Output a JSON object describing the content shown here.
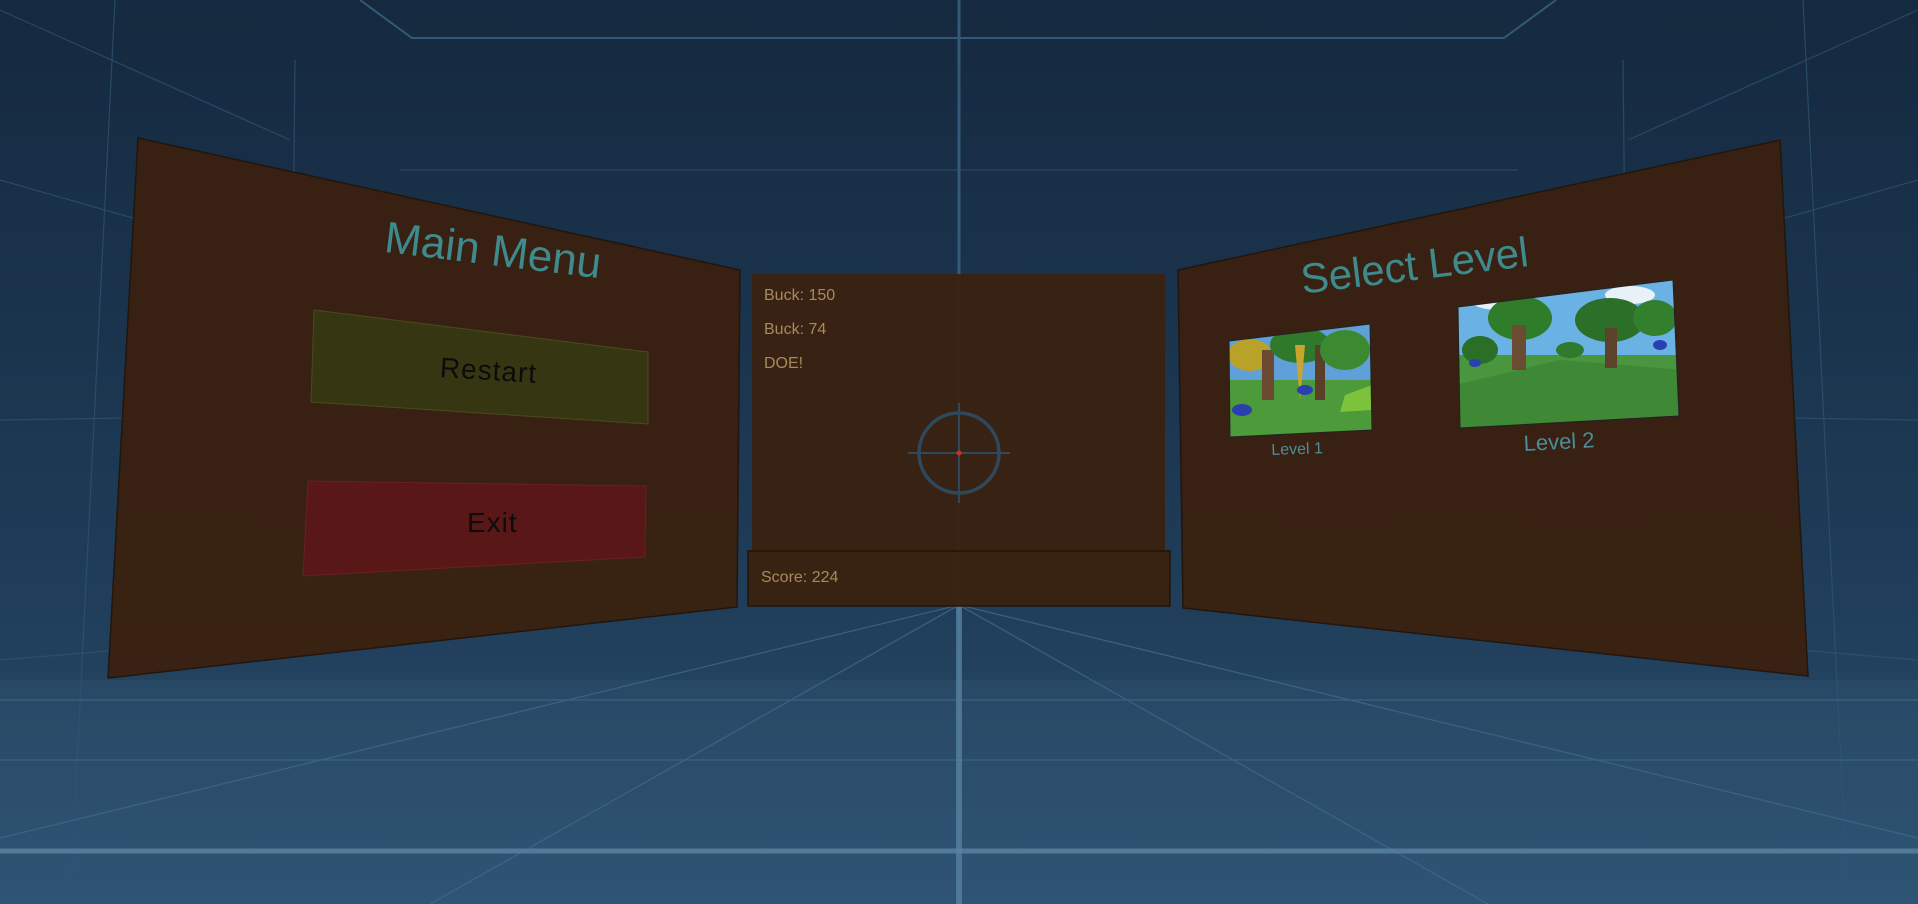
{
  "colors": {
    "panel": "#3a2110",
    "panel_edge": "#2a1608",
    "restart_button": "#363613",
    "exit_button": "#5a1717",
    "title_text": "#3e8a8c",
    "hud_text": "#a98a5a",
    "reticle": "#2d4d64",
    "reticle_dot": "#d03020"
  },
  "main_menu": {
    "title": "Main Menu",
    "restart_label": "Restart",
    "exit_label": "Exit"
  },
  "hud": {
    "kills": [
      "Buck: 150",
      "Buck: 74",
      "DOE!"
    ],
    "score": "Score: 224",
    "reticle_icon": "crosshair-icon"
  },
  "level_select": {
    "title": "Select Level",
    "levels": [
      {
        "label": "Level 1",
        "thumbnail": "forest-scene-thumbnail"
      },
      {
        "label": "Level 2",
        "thumbnail": "forest-scene-thumbnail"
      }
    ]
  }
}
